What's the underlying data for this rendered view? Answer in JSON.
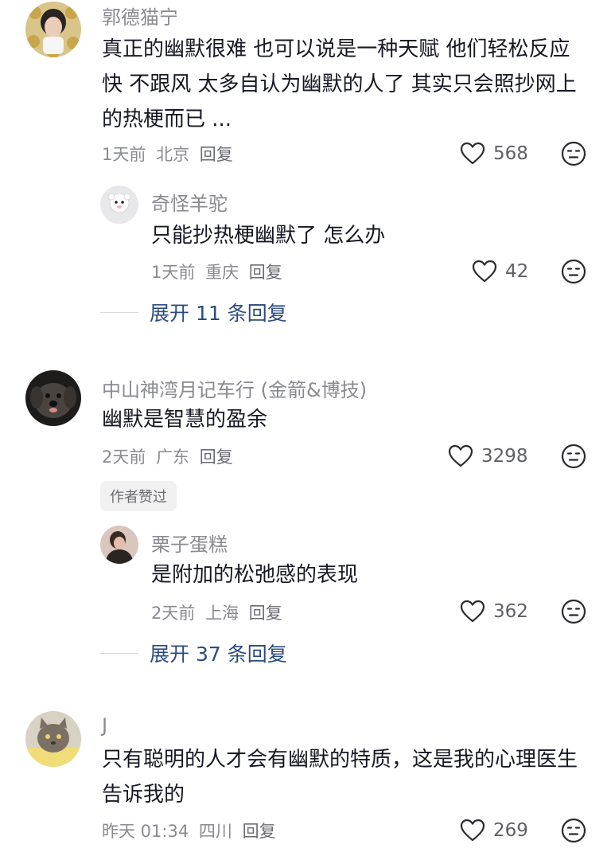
{
  "comments": [
    {
      "username": "郭德猫宁",
      "text": "真正的幽默很难 也可以说是一种天赋 他们轻松反应快 不跟风 太多自认为幽默的人了 其实只会照抄网上的热梗而已 ...",
      "time": "1天前",
      "location": "北京",
      "reply_label": "回复",
      "likes": "568",
      "sub_reply": {
        "username": "奇怪羊驼",
        "text": "只能抄热梗幽默了 怎么办",
        "time": "1天前",
        "location": "重庆",
        "reply_label": "回复",
        "likes": "42"
      },
      "expand_label": "展开 11 条回复"
    },
    {
      "username": "中山神湾月记车行 (金箭&博技)",
      "text": "幽默是智慧的盈余",
      "time": "2天前",
      "location": "广东",
      "reply_label": "回复",
      "likes": "3298",
      "badge": "作者赞过",
      "sub_reply": {
        "username": "栗子蛋糕",
        "text": "是附加的松弛感的表现",
        "time": "2天前",
        "location": "上海",
        "reply_label": "回复",
        "likes": "362"
      },
      "expand_label": "展开 37 条回复"
    },
    {
      "username": "J",
      "text": "只有聪明的人才会有幽默的特质，这是我的心理医生告诉我的",
      "time": "昨天 01:34",
      "location": "四川",
      "reply_label": "回复",
      "likes": "269"
    }
  ],
  "icons": {
    "like": "heart-outline-icon",
    "emoji": "neutral-face-icon"
  },
  "colors": {
    "username": "#8a8b91",
    "text": "#161823",
    "expand": "#2b4c7e",
    "icon": "#2a2b30"
  }
}
